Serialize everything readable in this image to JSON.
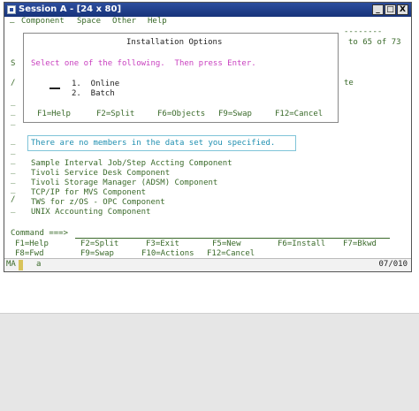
{
  "window": {
    "title": "Session A - [24 x 80]",
    "minimize": "_",
    "maximize": "□",
    "close": "X"
  },
  "menubar": {
    "left_mark": "–",
    "items": [
      "Component",
      "Space",
      "Other",
      "Help"
    ],
    "dashes": "--------"
  },
  "background": {
    "count": "to 65 of 73",
    "s_col": "S",
    "slash1": "/",
    "te": "te",
    "underscores": [
      "_",
      "_",
      "_",
      "_",
      "_",
      "_",
      "_",
      "_",
      "_",
      "_"
    ],
    "slash2": "/"
  },
  "popup": {
    "title": "Installation Options",
    "instruction": "Select one of the following.  Then press Enter.",
    "options": [
      "1.  Online",
      "2.  Batch"
    ],
    "fkeys": [
      "F1=Help",
      "F2=Split",
      "F6=Objects",
      "F9=Swap",
      "F12=Cancel"
    ]
  },
  "message": "There are no members in the data set you specified.",
  "components": [
    "Sample Interval Job/Step Accting Component",
    "Tivoli Service Desk Component",
    "Tivoli Storage Manager (ADSM) Component",
    "TCP/IP for MVS Component",
    "TWS for z/OS - OPC Component",
    "UNIX Accounting Component"
  ],
  "command": {
    "prompt": "Command ===>",
    "fkeys_row1": [
      "F1=Help",
      "F2=Split",
      "F3=Exit",
      "F5=New",
      "F6=Install",
      "F7=Bkwd"
    ],
    "fkeys_row2": [
      "F8=Fwd",
      "F9=Swap",
      "F10=Actions",
      "F12=Cancel"
    ]
  },
  "status": {
    "ma": "MA",
    "session": "a",
    "position": "07/010"
  }
}
